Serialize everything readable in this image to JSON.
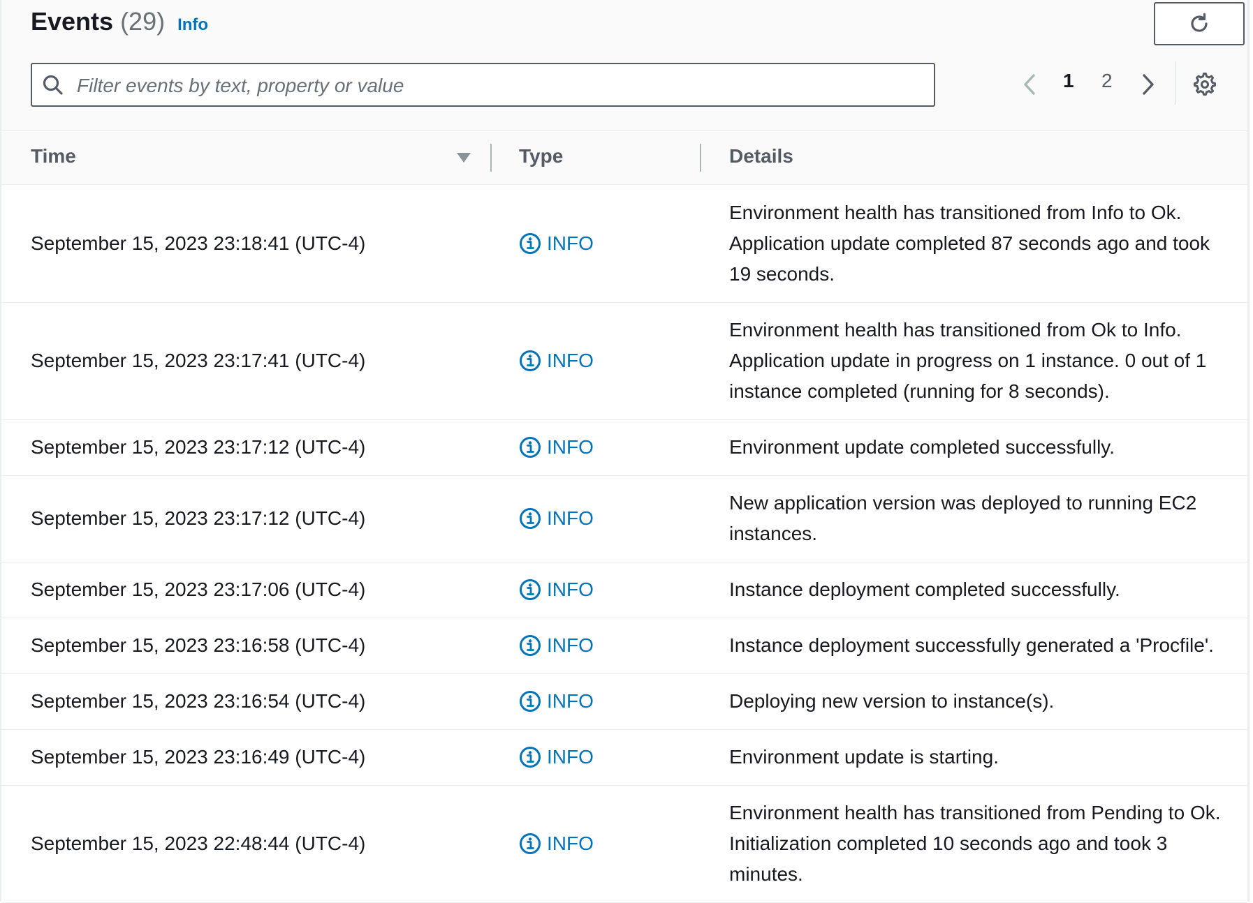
{
  "header": {
    "title": "Events",
    "count": "(29)",
    "info_link": "Info",
    "refresh_icon": "refresh-icon"
  },
  "search": {
    "placeholder": "Filter events by text, property or value",
    "value": "",
    "icon": "search-icon"
  },
  "pagination": {
    "pages": [
      "1",
      "2"
    ],
    "current_page": "1",
    "prev_icon": "chevron-left-icon",
    "next_icon": "chevron-right-icon",
    "settings_icon": "gear-icon"
  },
  "table": {
    "columns": [
      "Time",
      "Type",
      "Details"
    ],
    "sort_icon": "sort-descending-icon",
    "rows": [
      {
        "time": "September 15, 2023 23:18:41 (UTC-4)",
        "type": "INFO",
        "details": "Environment health has transitioned from Info to Ok. Application update completed 87 seconds ago and took 19 seconds."
      },
      {
        "time": "September 15, 2023 23:17:41 (UTC-4)",
        "type": "INFO",
        "details": "Environment health has transitioned from Ok to Info. Application update in progress on 1 instance. 0 out of 1 instance completed (running for 8 seconds)."
      },
      {
        "time": "September 15, 2023 23:17:12 (UTC-4)",
        "type": "INFO",
        "details": "Environment update completed successfully."
      },
      {
        "time": "September 15, 2023 23:17:12 (UTC-4)",
        "type": "INFO",
        "details": "New application version was deployed to running EC2 instances."
      },
      {
        "time": "September 15, 2023 23:17:06 (UTC-4)",
        "type": "INFO",
        "details": "Instance deployment completed successfully."
      },
      {
        "time": "September 15, 2023 23:16:58 (UTC-4)",
        "type": "INFO",
        "details": "Instance deployment successfully generated a 'Procfile'."
      },
      {
        "time": "September 15, 2023 23:16:54 (UTC-4)",
        "type": "INFO",
        "details": "Deploying new version to instance(s)."
      },
      {
        "time": "September 15, 2023 23:16:49 (UTC-4)",
        "type": "INFO",
        "details": "Environment update is starting."
      },
      {
        "time": "September 15, 2023 22:48:44 (UTC-4)",
        "type": "INFO",
        "details": "Environment health has transitioned from Pending to Ok. Initialization completed 10 seconds ago and took 3 minutes."
      }
    ]
  },
  "colors": {
    "link": "#0073bb",
    "text": "#16191f",
    "muted": "#545b64"
  }
}
